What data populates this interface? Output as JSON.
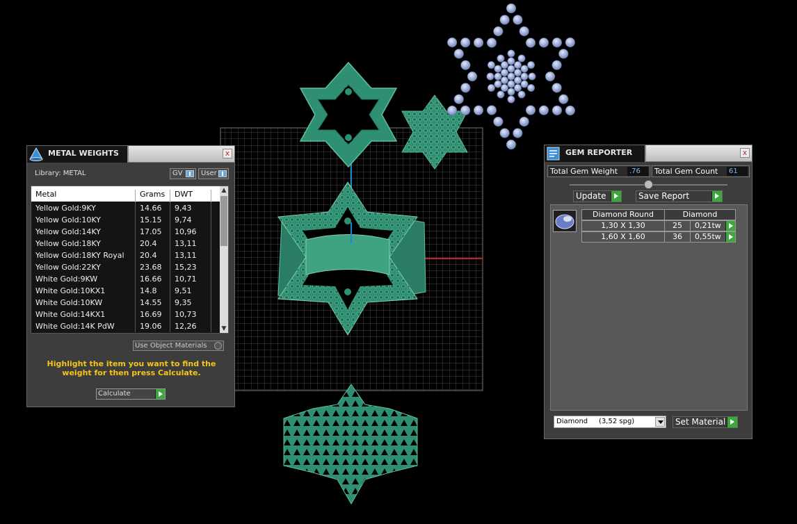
{
  "metal_weights": {
    "title": "METAL WEIGHTS",
    "close": "x",
    "library_label": "Library: METAL",
    "toggles": [
      "GV",
      "User"
    ],
    "columns": [
      "Metal",
      "Grams",
      "DWT"
    ],
    "rows": [
      {
        "metal": "Yellow Gold:9KY",
        "grams": "14.66",
        "dwt": "9,43"
      },
      {
        "metal": "Yellow Gold:10KY",
        "grams": "15.15",
        "dwt": "9,74"
      },
      {
        "metal": "Yellow Gold:14KY",
        "grams": "17.05",
        "dwt": "10,96"
      },
      {
        "metal": "Yellow Gold:18KY",
        "grams": "20.4",
        "dwt": "13,11"
      },
      {
        "metal": "Yellow Gold:18KY Royal",
        "grams": "20.4",
        "dwt": "13,11"
      },
      {
        "metal": "Yellow Gold:22KY",
        "grams": "23.68",
        "dwt": "15,23"
      },
      {
        "metal": "White Gold:9KW",
        "grams": "16.66",
        "dwt": "10,71"
      },
      {
        "metal": "White Gold:10KX1",
        "grams": "14.8",
        "dwt": "9,51"
      },
      {
        "metal": "White Gold:10KW",
        "grams": "14.55",
        "dwt": "9,35"
      },
      {
        "metal": "White Gold:14KX1",
        "grams": "16.69",
        "dwt": "10,73"
      },
      {
        "metal": "White Gold:14K PdW",
        "grams": "19.06",
        "dwt": "12,26"
      }
    ],
    "use_object_materials": "Use Object Materials",
    "hint": "Highlight the item you want to find the weight for then press Calculate.",
    "calculate": "Calculate"
  },
  "gem_reporter": {
    "title": "GEM REPORTER",
    "close": "x",
    "total_weight_label": "Total Gem Weight",
    "total_weight_value": ".76",
    "total_count_label": "Total Gem Count",
    "total_count_value": "61",
    "update": "Update",
    "save_report": "Save Report",
    "gem_header": [
      "Diamond Round",
      "Diamond"
    ],
    "gems": [
      {
        "size": "1,30 X 1,30",
        "count": "25",
        "weight": "0,21tw"
      },
      {
        "size": "1,60 X 1,60",
        "count": "36",
        "weight": "0,55tw"
      }
    ],
    "material_select": "Diamond     (3,52 spg)",
    "set_material": "Set Material"
  },
  "colors": {
    "model_green": "#2f8f73",
    "gem_blue": "#9fb0d8",
    "hint_yellow": "#f5c518",
    "go_green": "#3aa83a"
  }
}
